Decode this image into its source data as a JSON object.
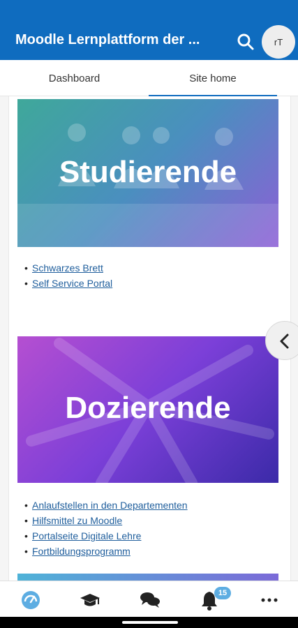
{
  "app": {
    "title": "Moodle Lernplattform der ...",
    "avatar_initials": "rT",
    "accent_color": "#0f6cbf"
  },
  "tabs": [
    {
      "label": "Dashboard",
      "selected": false
    },
    {
      "label": "Site home",
      "selected": true
    }
  ],
  "sections": [
    {
      "banner_text": "Studierende",
      "links": [
        "Schwarzes Brett",
        "Self Service Portal"
      ]
    },
    {
      "banner_text": "Dozierende",
      "links": [
        "Anlaufstellen in den Departementen",
        "Hilfsmittel zu Moodle",
        "Portalseite Digitale Lehre",
        "Fortbildungsprogramm"
      ]
    }
  ],
  "bottom_nav": {
    "items": [
      "dashboard-icon",
      "courses-icon",
      "messages-icon",
      "notifications-icon",
      "more-icon"
    ],
    "notifications_badge": "15"
  },
  "icons": {
    "search": "search-icon",
    "drawer_toggle": "chevron-left-icon"
  }
}
